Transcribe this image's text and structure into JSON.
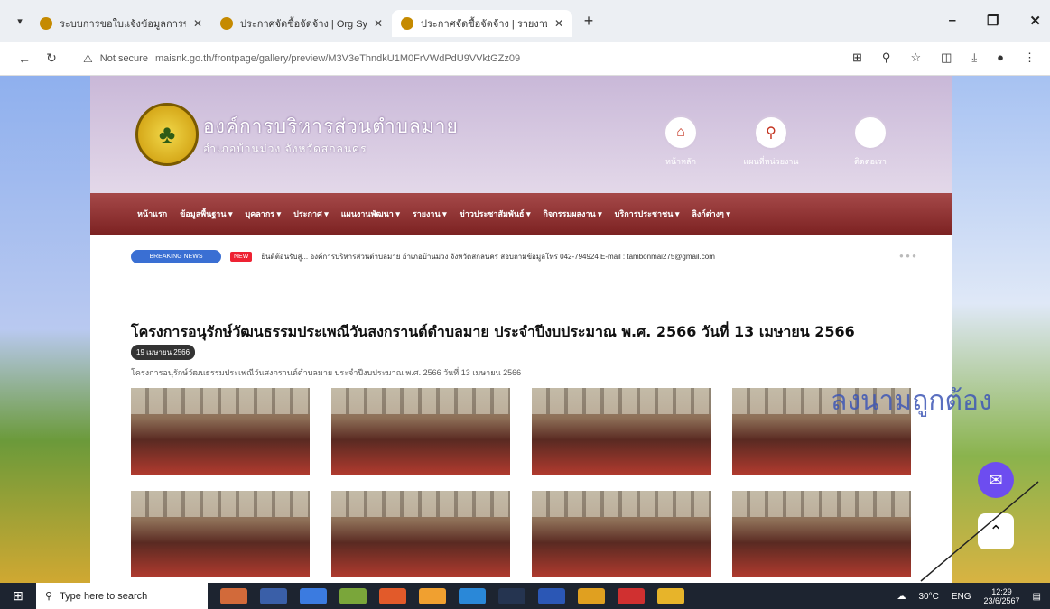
{
  "browser": {
    "tabs": [
      {
        "title": "ระบบการขอใบแจ้งข้อมูลการขอ",
        "active": false
      },
      {
        "title": "ประกาศจัดซื้อจัดจ้าง | Org System",
        "active": false
      },
      {
        "title": "ประกาศจัดซื้อจัดจ้าง | รายงานผล",
        "active": true
      }
    ],
    "not_secure": "Not secure",
    "url": "maisnk.go.th/frontpage/gallery/preview/M3V3eThndkU1M0FrVWdPdU9VVktGZz09"
  },
  "site": {
    "org_name": "องค์การบริหารส่วนตำบลมาย",
    "org_sub": "อำเภอบ้านม่วง จังหวัดสกลนคร",
    "header_icons": [
      {
        "icon": "home-icon",
        "label": "หน้าหลัก",
        "glyph": "⌂"
      },
      {
        "icon": "map-pin-icon",
        "label": "แผนที่หน่วยงาน",
        "glyph": "⚲"
      },
      {
        "icon": "phone-icon",
        "label": "ติดต่อเรา",
        "glyph": ""
      }
    ],
    "menu": [
      "หน้าแรก",
      "ข้อมูลพื้นฐาน ▾",
      "บุคลากร ▾",
      "ประกาศ ▾",
      "แผนงานพัฒนา ▾",
      "รายงาน ▾",
      "ข่าวประชาสัมพันธ์ ▾",
      "กิจกรรมผลงาน ▾",
      "บริการประชาชน ▾",
      "ลิงก์ต่างๆ ▾"
    ],
    "breaking_label": "BREAKING NEWS",
    "new_label": "NEW",
    "ticker": "ยินดีต้อนรับสู่... องค์การบริหารส่วนตำบลมาย อำเภอบ้านม่วง จังหวัดสกลนคร สอบถามข้อมูลโทร 042-794924 E-mail : tambonmai275@gmail.com"
  },
  "article": {
    "title": "โครงการอนุรักษ์วัฒนธรรมประเพณีวันสงกรานต์ตำบลมาย ประจำปีงบประมาณ พ.ศ. 2566 วันที่ 13 เมษายน 2566",
    "date": "19 เมษายน 2566",
    "description": "โครงการอนุรักษ์วัฒนธรรมประเพณีวันสงกรานต์ตำบลมาย ประจำปีงบประมาณ พ.ศ. 2566 วันที่ 13 เมษายน 2566",
    "photo_count": 8
  },
  "overlay_handwriting": "ลงนามถูกต้อง",
  "taskbar": {
    "search_placeholder": "Type here to search",
    "weather": "30°C",
    "lang": "ENG",
    "time": "12:29",
    "date": "23/6/2567"
  },
  "colors": {
    "menu_bar": "#8e2f2f",
    "breaking_badge": "#3a6fd3",
    "header_band": "#d5c8e2"
  }
}
